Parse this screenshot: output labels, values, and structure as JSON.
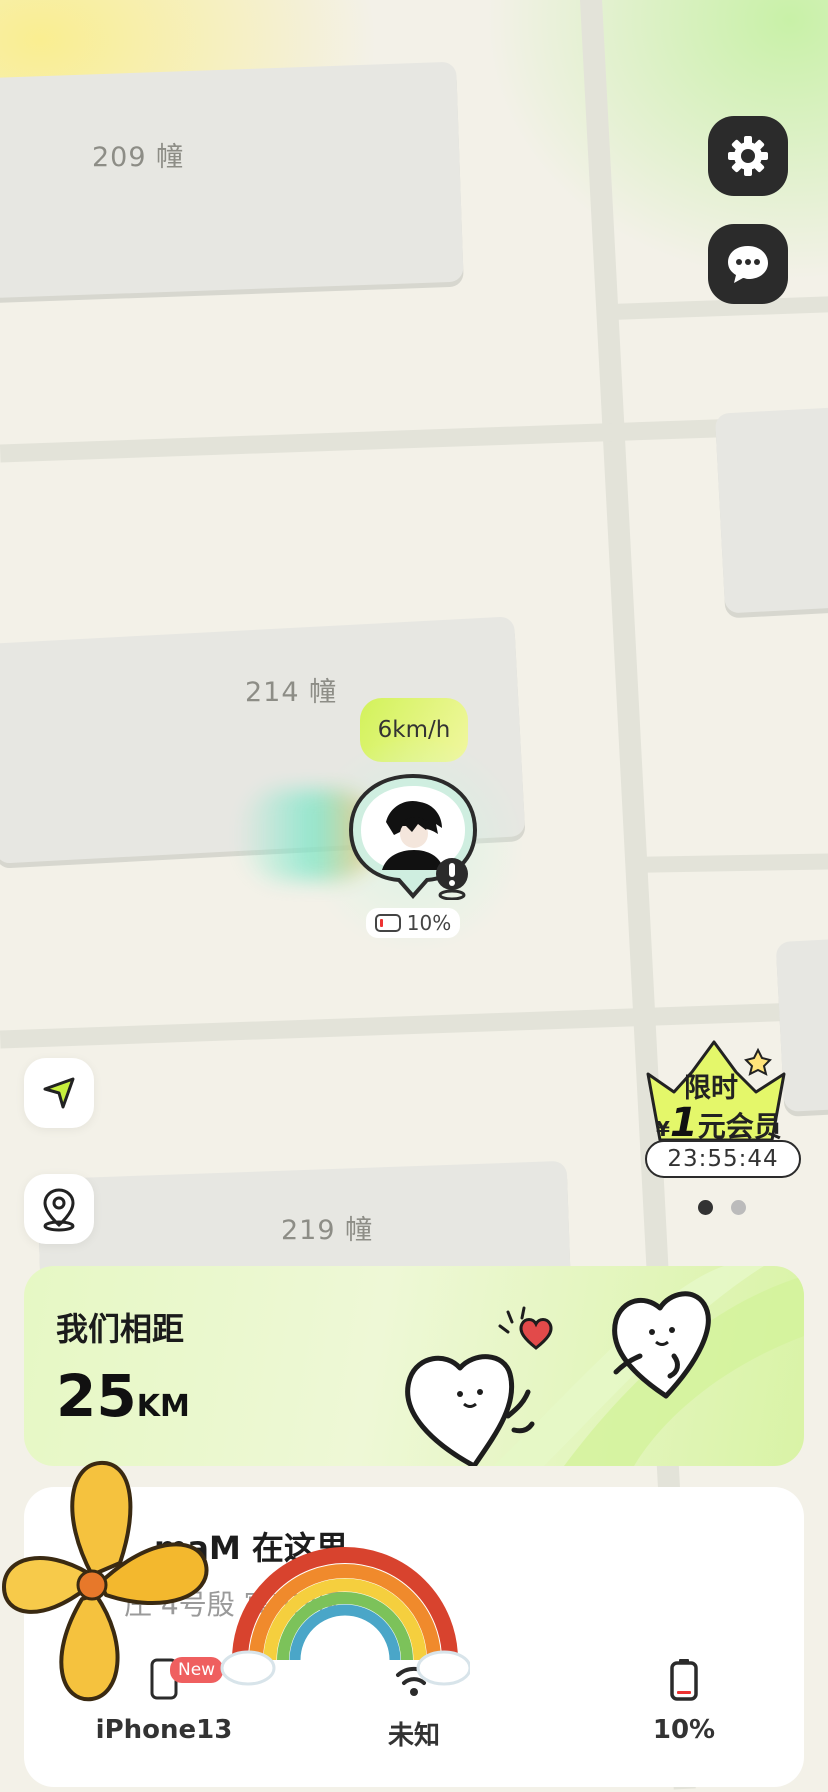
{
  "map": {
    "buildings": [
      {
        "label": "209 幢"
      },
      {
        "label": "214 幢"
      },
      {
        "label": "219 幢"
      }
    ]
  },
  "controls": {
    "settings_icon": "gear-icon",
    "chat_icon": "chat-bubble-icon",
    "locate_icon": "navigation-arrow-icon",
    "pin_icon": "map-pin-icon"
  },
  "partner": {
    "speed": "6km/h",
    "battery": "10%"
  },
  "promo": {
    "line1": "限时",
    "line2_prefix": "¥",
    "line2_big": "1",
    "line2_text": "元会员",
    "countdown": "23:55:44"
  },
  "distance": {
    "title": "我们相距",
    "value": "25",
    "unit": "KM"
  },
  "location": {
    "title": "maM 在这里",
    "address_visible": "庄    4号殷      寓东3区"
  },
  "status_tabs": [
    {
      "label": "iPhone13",
      "badge": "New",
      "icon": "phone-icon"
    },
    {
      "label": "未知",
      "icon": "wifi-icon"
    },
    {
      "label": "10%",
      "icon": "battery-icon"
    }
  ],
  "colors": {
    "accent_green": "#d2f25a",
    "dark": "#2b2b2b",
    "badge_red": "#ef5f5f"
  }
}
